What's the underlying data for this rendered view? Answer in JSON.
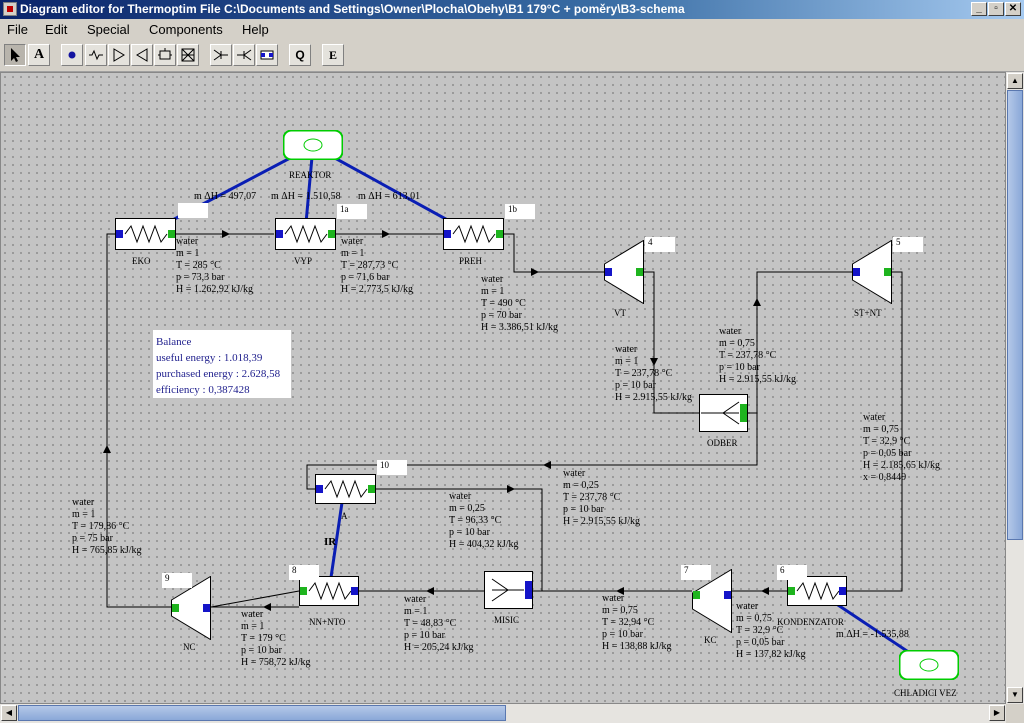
{
  "window": {
    "title": "Diagram editor for Thermoptim  File  C:\\Documents and Settings\\Owner\\Plocha\\Obehy\\B1 179°C + poměry\\B3-schema"
  },
  "menu": [
    "File",
    "Edit",
    "Special",
    "Components",
    "Help"
  ],
  "toolbar": {
    "tools": [
      "select-tool",
      "text-tool",
      "node-tool",
      "exchanger-tool",
      "compressor-tool",
      "expansion-tool",
      "combustion-tool",
      "throttle-tool",
      "mixer-tool",
      "divider-tool",
      "heat-exchanger-tool",
      "heat-transfer-tool",
      "external-component-tool"
    ],
    "text_tool": "A",
    "heat_tool": "Q",
    "external_tool": "E"
  },
  "components": {
    "eko": "EKO",
    "vyp": "VYP",
    "preh": "PREH",
    "vt": "VT",
    "st_nt": "ST+NT",
    "odber": "ODBER",
    "a": "A",
    "nn_nto": "NN+NTO",
    "misic": "MISIC",
    "kc": "KC",
    "kondenzator": "KONDENZATOR",
    "nc": "NC",
    "reaktor": "REAKTOR",
    "chladici_vez": "CHLADICI VEZ"
  },
  "node_labels": {
    "eko_out": "",
    "n1a": "1a",
    "n1b": "1b",
    "n4": "4",
    "n5": "5",
    "n10": "10",
    "n9": "9",
    "n8": "8",
    "n7": "7",
    "n6": "6"
  },
  "exchanges": {
    "eko": "m ΔH = 497,07",
    "vyp": "m ΔH = 1.510,58",
    "preh": "m ΔH = 613,01",
    "kondenzator": "m ΔH = -1.535,88"
  },
  "points": {
    "p_eko_vyp": [
      "water",
      "m = 1",
      "T = 285 °C",
      "p = 73,3 bar",
      "H = 1.262,92 kJ/kg"
    ],
    "p_vyp_preh": [
      "water",
      "m = 1",
      "T = 287,73 °C",
      "p = 71,6 bar",
      "H = 2.773,5 kJ/kg"
    ],
    "p_preh_vt": [
      "water",
      "m = 1",
      "T = 490 °C",
      "p = 70 bar",
      "H = 3.386,51 kJ/kg"
    ],
    "p_vt_out": [
      "water",
      "m = 1",
      "T = 237,78 °C",
      "p = 10 bar",
      "H = 2.915,55 kJ/kg"
    ],
    "p_odber_st": [
      "water",
      "m = 0,75",
      "T = 237,78 °C",
      "p = 10 bar",
      "H = 2.915,55 kJ/kg"
    ],
    "p_st_out": [
      "water",
      "m = 0,75",
      "T = 32,9 °C",
      "p = 0,05 bar",
      "H = 2.185,65 kJ/kg",
      "x = 0,8449"
    ],
    "p_odber_a": [
      "water",
      "m = 0,25",
      "T = 237,78 °C",
      "p = 10 bar",
      "H = 2.915,55 kJ/kg"
    ],
    "p_a_out": [
      "water",
      "m = 0,25",
      "T = 96,33 °C",
      "p = 10 bar",
      "H = 404,32 kJ/kg"
    ],
    "p_nc_in": [
      "water",
      "m = 1",
      "T = 179,86 °C",
      "p = 75 bar",
      "H = 765,85 kJ/kg"
    ],
    "p_nc_out": [
      "water",
      "m = 1",
      "T = 179 °C",
      "p = 10 bar",
      "H = 758,72 kJ/kg"
    ],
    "p_misic_out": [
      "water",
      "m = 1",
      "T = 48,83 °C",
      "p = 10 bar",
      "H = 205,24 kJ/kg"
    ],
    "p_kc_out": [
      "water",
      "m = 0,75",
      "T = 32,94 °C",
      "p = 10 bar",
      "H = 138,88 kJ/kg"
    ],
    "p_kond_out": [
      "water",
      "m = 0,75",
      "T = 32,9 °C",
      "p = 0,05 bar",
      "H = 137,82 kJ/kg"
    ]
  },
  "balance": {
    "title": "Balance",
    "useful": "useful energy : 1.018,39",
    "purchased": "purchased energy : 2.628,58",
    "efficiency": "efficiency : 0,387428"
  },
  "ir_label": "IR",
  "colors": {
    "pipe": "#000000",
    "heat_link": "#0a1eb4",
    "inlet_port": "#1414c8",
    "outlet_port": "#1eb41e",
    "source_ring": "#00cc00"
  }
}
